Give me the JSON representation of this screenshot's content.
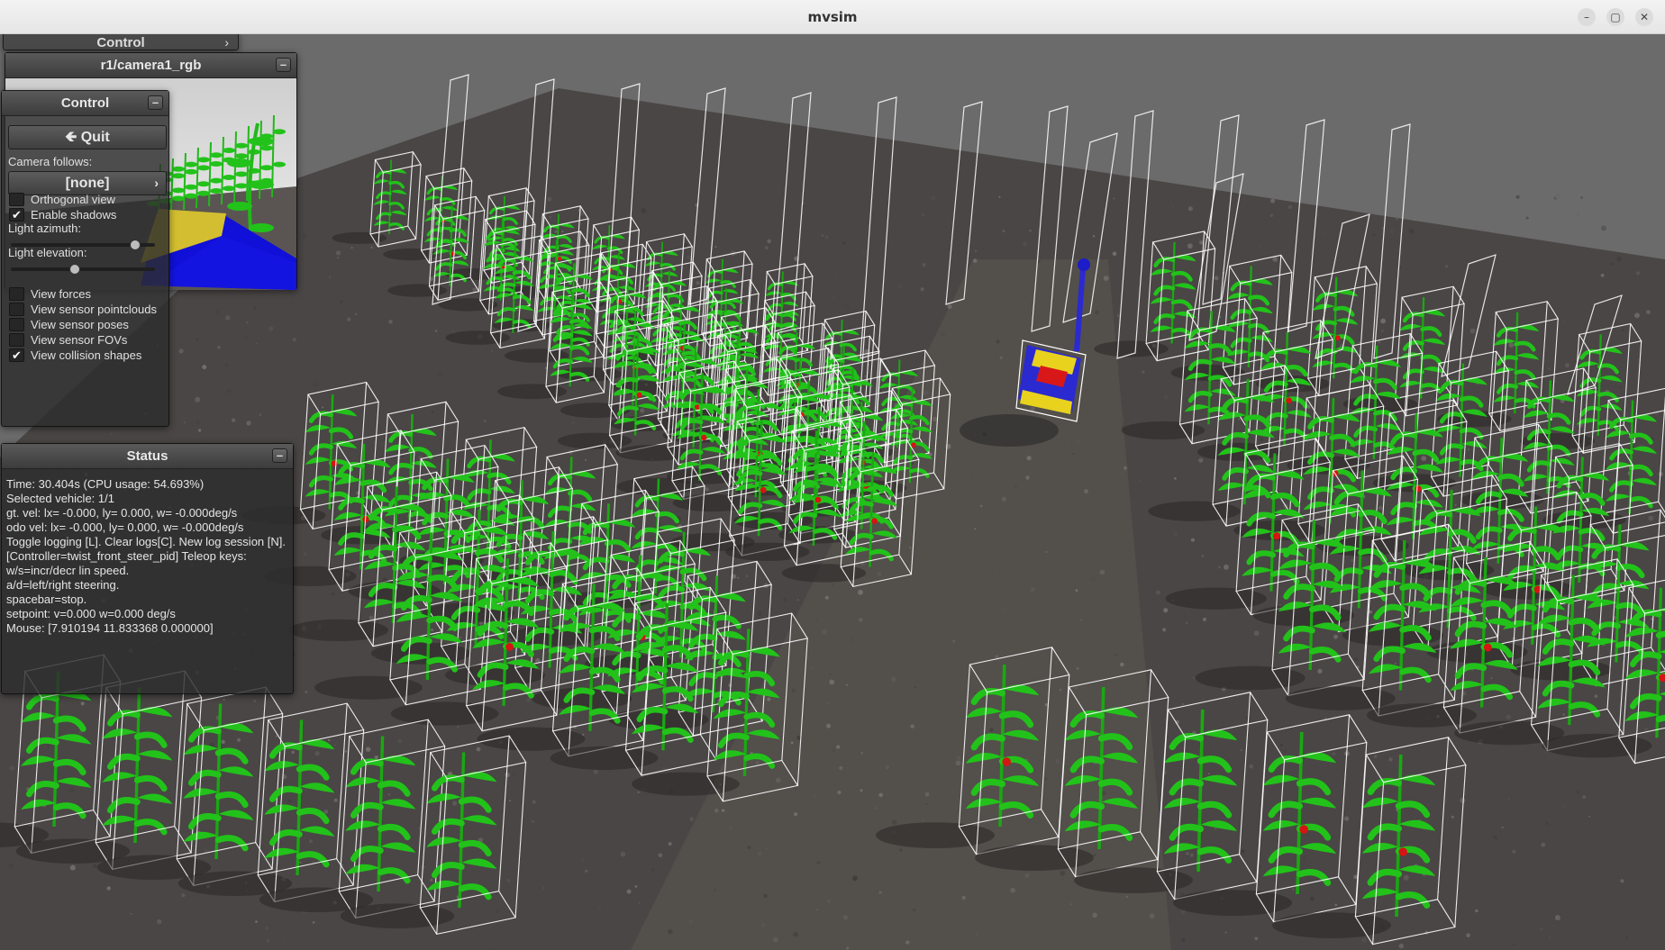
{
  "window": {
    "title": "mvsim",
    "minimize_glyph": "–",
    "maximize_glyph": "▢",
    "close_glyph": "✕"
  },
  "back_control": {
    "title": "Control",
    "arrow": "›"
  },
  "camera_window": {
    "title": "r1/camera1_rgb",
    "minimize_glyph": "–"
  },
  "control_panel": {
    "title": "Control",
    "minimize_glyph": "–",
    "quit_label": "Quit",
    "quit_icon": "exit-arrow-icon",
    "camera_follows_label": "Camera follows:",
    "camera_follows_value": "[none]",
    "camera_follows_arrow": "›",
    "checkboxes": [
      {
        "label": "Orthogonal view",
        "checked": false
      },
      {
        "label": "Enable shadows",
        "checked": true
      }
    ],
    "light_azimuth_label": "Light azimuth:",
    "light_azimuth_value": 0.88,
    "light_elevation_label": "Light elevation:",
    "light_elevation_value": 0.43,
    "view_checkboxes": [
      {
        "label": "View forces",
        "checked": false
      },
      {
        "label": "View sensor pointclouds",
        "checked": false
      },
      {
        "label": "View sensor poses",
        "checked": false
      },
      {
        "label": "View sensor FOVs",
        "checked": false
      },
      {
        "label": "View collision shapes",
        "checked": true
      }
    ]
  },
  "status_panel": {
    "title": "Status",
    "minimize_glyph": "–",
    "lines": [
      "Time: 30.404s (CPU usage: 54.693%)",
      "Selected vehicle: 1/1",
      "gt. vel: lx= -0.000, ly= 0.000, w= -0.000deg/s",
      "odo vel: lx= -0.000, ly= 0.000, w= -0.000deg/s",
      "Toggle logging [L]. Clear logs[C]. New log session [N].",
      "[Controller=twist_front_steer_pid] Teleop keys:",
      "w/s=incr/decr lin speed.",
      "a/d=left/right steering.",
      "spacebar=stop.",
      "setpoint: v=0.000 w=0.000 deg/s",
      "Mouse: [7.910194 11.833368 0.000000]"
    ]
  },
  "scene_colors": {
    "sky": "#6b6b6b",
    "ground": "#4a4645",
    "plant": "#22c21a",
    "wire": "#ffffff",
    "robot_body": "#2a2ad0",
    "robot_accent": "#e8d21e"
  }
}
